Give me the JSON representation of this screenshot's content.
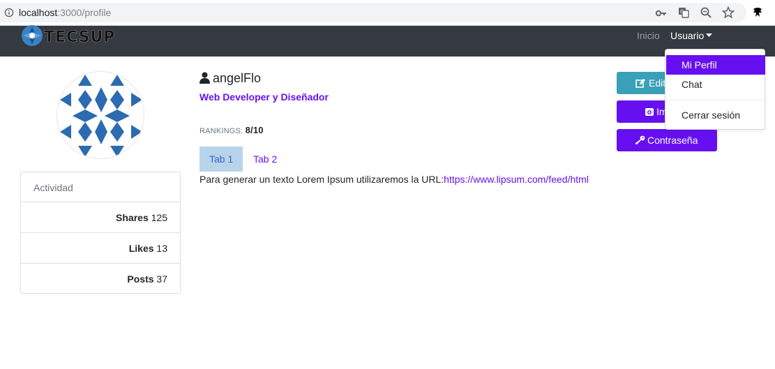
{
  "browser": {
    "url_host": "localhost",
    "url_rest": ":3000/profile"
  },
  "navbar": {
    "brand": "TECSUP",
    "inicio": "Inicio",
    "usuario": "Usuario"
  },
  "dropdown": {
    "items": [
      "Mi Perfil",
      "Chat",
      "Cerrar sesión"
    ]
  },
  "profile": {
    "username": "angelFlo",
    "role": "Web Developer y Diseñador",
    "rankings_label": "RANKINGS:",
    "rankings_value": "8/10"
  },
  "activity": {
    "title": "Actividad",
    "rows": [
      {
        "label": "Shares",
        "value": "125"
      },
      {
        "label": "Likes",
        "value": "13"
      },
      {
        "label": "Posts",
        "value": "37"
      }
    ]
  },
  "tabs": [
    "Tab 1",
    "Tab 2"
  ],
  "content": {
    "text": "Para generar un texto Lorem Ipsum utilizaremos la URL:",
    "link": "https://www.lipsum.com/feed/html"
  },
  "buttons": {
    "edit": "Editar",
    "image": "Imagen",
    "password": "Contraseña"
  },
  "colors": {
    "accent": "#6610f2",
    "navbar": "#343a40",
    "edit_button": "#3aa0b8",
    "tab_active": "#b8d4ea"
  }
}
